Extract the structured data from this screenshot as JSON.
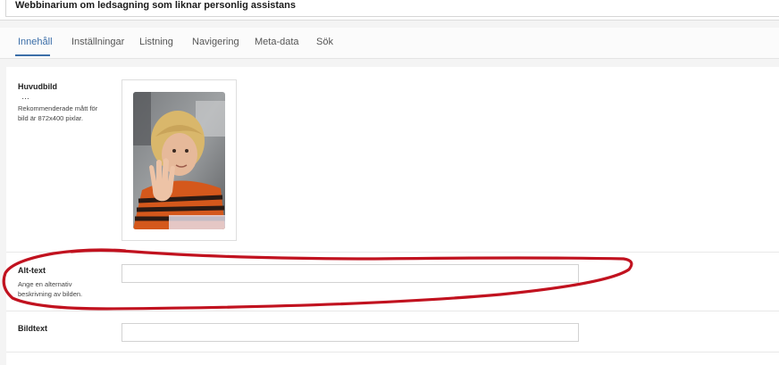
{
  "page": {
    "title_value": "Webbinarium om ledsagning som liknar personlig assistans"
  },
  "tabs": [
    {
      "label": "Innehåll",
      "active": true
    },
    {
      "label": "Inställningar",
      "active": false
    },
    {
      "label": "Listning",
      "active": false
    },
    {
      "label": "Navigering",
      "active": false
    },
    {
      "label": "Meta-data",
      "active": false
    },
    {
      "label": "Sök",
      "active": false
    }
  ],
  "main_image": {
    "label": "Huvudbild",
    "menu_glyph": "…",
    "help": "Rekommenderade mått för bild är 872x400 pixlar.",
    "icon": "photo-of-child-waving"
  },
  "alt_text": {
    "label": "Alt-text",
    "help": "Ange en alternativ beskrivning av bilden.",
    "value": "",
    "placeholder": ""
  },
  "caption": {
    "label": "Bildtext",
    "value": "",
    "placeholder": ""
  },
  "colors": {
    "accent": "#3b6ea8",
    "annotation": "#c1121f"
  }
}
